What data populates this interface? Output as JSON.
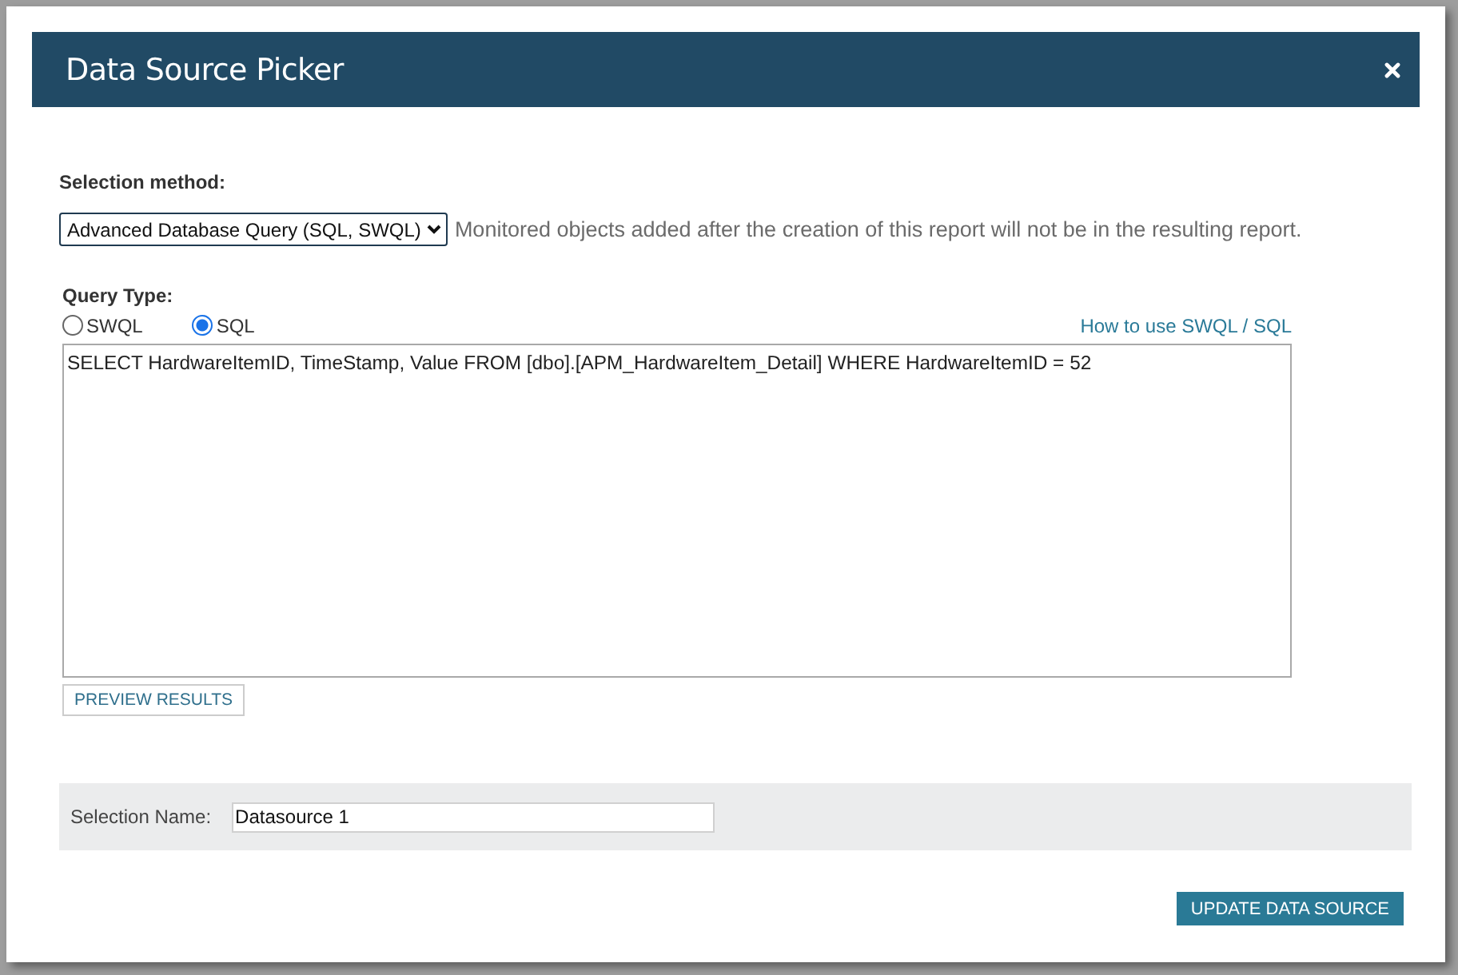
{
  "dialog": {
    "title": "Data Source Picker"
  },
  "selection_method": {
    "label": "Selection method:",
    "value": "Advanced Database Query (SQL, SWQL)",
    "note": "Monitored objects added after the creation of this report will not be in the resulting report."
  },
  "query_type": {
    "label": "Query Type:",
    "options": [
      {
        "label": "SWQL",
        "selected": false
      },
      {
        "label": "SQL",
        "selected": true
      }
    ],
    "help_link": "How to use SWQL / SQL",
    "query": "SELECT HardwareItemID, TimeStamp, Value FROM [dbo].[APM_HardwareItem_Detail] WHERE HardwareItemID = 52",
    "preview_button": "PREVIEW RESULTS"
  },
  "selection_name": {
    "label": "Selection Name:",
    "value": "Datasource 1"
  },
  "buttons": [
    "UPDATE DATA SOURCE"
  ]
}
